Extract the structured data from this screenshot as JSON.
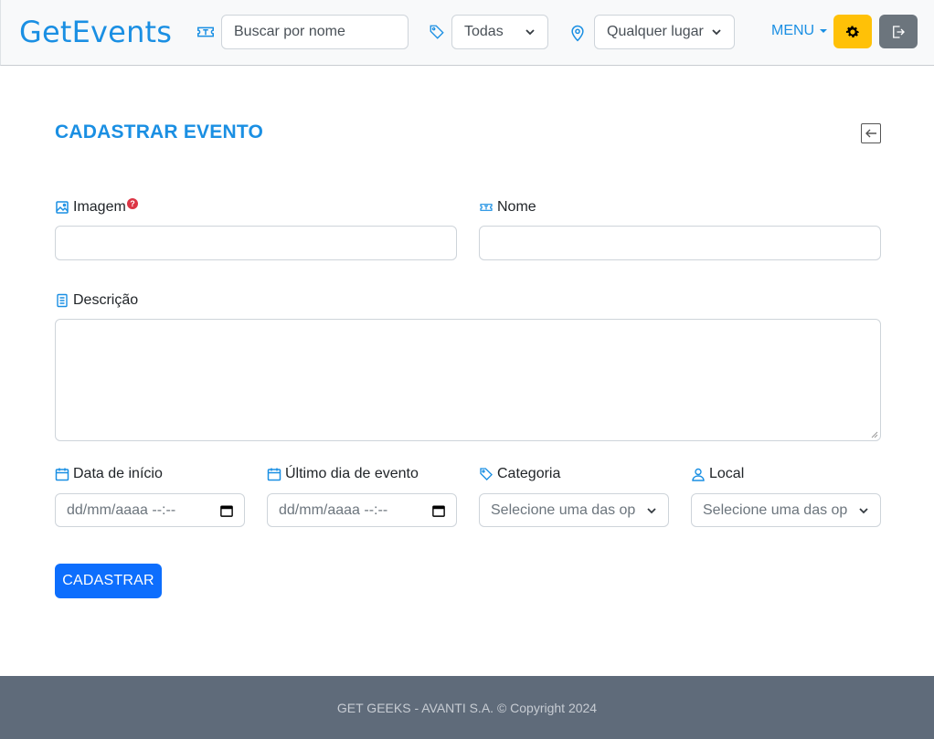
{
  "navbar": {
    "brand": "GetEvents",
    "search": {
      "placeholder": "Buscar por nome",
      "icon": "ticket-icon"
    },
    "category_filter": {
      "value": "Todas",
      "icon": "tag-icon"
    },
    "location_filter": {
      "value": "Qualquer lugar",
      "icon": "map-pin-icon"
    },
    "menu_label": "MENU",
    "settings_button": {
      "icon": "gear-icon",
      "color": "#ffc107"
    },
    "logout_button": {
      "icon": "logout-icon",
      "color": "#6c757d"
    }
  },
  "form": {
    "title": "CADASTRAR EVENTO",
    "back_icon": "arrow-left-square-icon",
    "fields": {
      "image": {
        "label": "Imagem",
        "help": "?",
        "value": ""
      },
      "name": {
        "label": "Nome",
        "value": ""
      },
      "description": {
        "label": "Descrição",
        "value": ""
      },
      "start_date": {
        "label": "Data de início",
        "placeholder": "dd/mm/aaaa --:--"
      },
      "end_date": {
        "label": "Último dia de evento",
        "placeholder": "dd/mm/aaaa --:--"
      },
      "category": {
        "label": "Categoria",
        "placeholder": "Selecione uma das opções"
      },
      "location": {
        "label": "Local",
        "placeholder": "Selecione uma das opções"
      }
    },
    "submit_label": "CADASTRAR"
  },
  "footer": {
    "text": "GET GEEKS - AVANTI S.A. © Copyright 2024"
  },
  "colors": {
    "accent": "#1a8fe3",
    "primary_button": "#0d6efd",
    "footer_bg": "#5f6b7a",
    "help_badge": "#dc3545"
  }
}
